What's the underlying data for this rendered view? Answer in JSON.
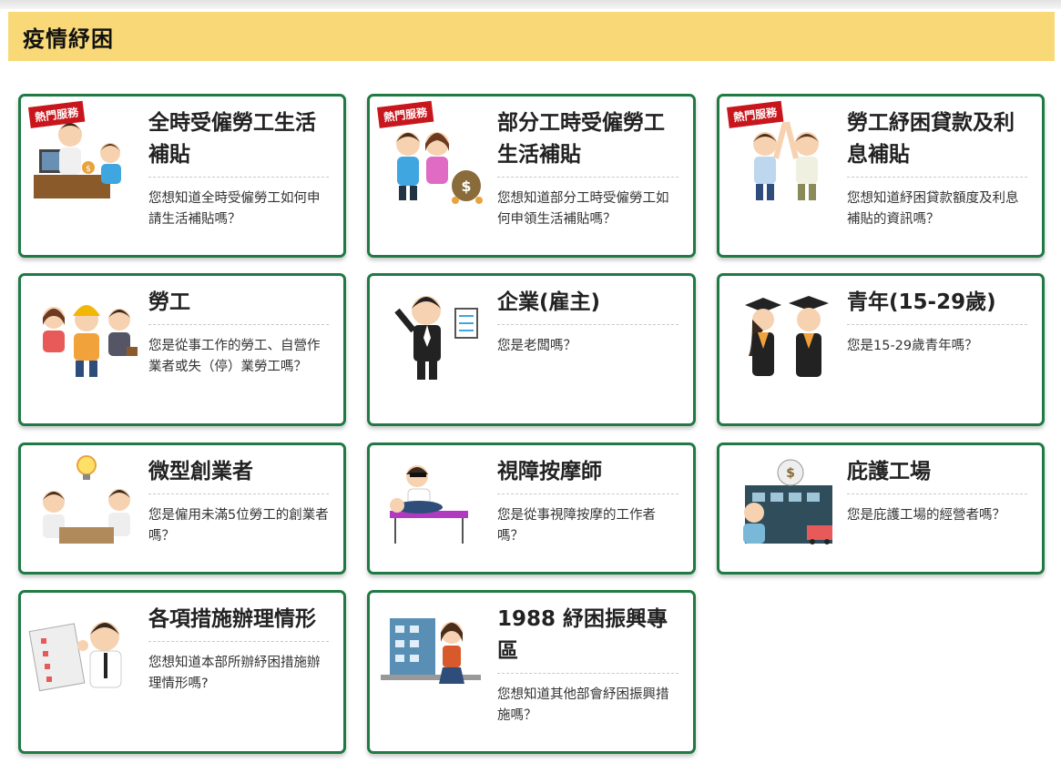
{
  "header": {
    "title": "疫情紓困"
  },
  "hot_label": "熱門服務",
  "cards": [
    {
      "title": "全時受僱勞工生活補貼",
      "desc": "您想知道全時受僱勞工如何申請生活補貼嗎？",
      "hot": true
    },
    {
      "title": "部分工時受僱勞工生活補貼",
      "desc": "您想知道部分工時受僱勞工如何申領生活補貼嗎？",
      "hot": true
    },
    {
      "title": "勞工紓困貸款及利息補貼",
      "desc": "您想知道紓困貸款額度及利息補貼的資訊嗎？",
      "hot": true
    },
    {
      "title": "勞工",
      "desc": "您是從事工作的勞工、自營作業者或失（停）業勞工嗎？",
      "hot": false
    },
    {
      "title": "企業(雇主)",
      "desc": "您是老闆嗎？",
      "hot": false
    },
    {
      "title": "青年(15-29歲)",
      "desc": "您是15-29歲青年嗎？",
      "hot": false
    },
    {
      "title": "微型創業者",
      "desc": "您是僱用未滿5位勞工的創業者嗎？",
      "hot": false
    },
    {
      "title": "視障按摩師",
      "desc": "您是從事視障按摩的工作者嗎？",
      "hot": false
    },
    {
      "title": "庇護工場",
      "desc": "您是庇護工場的經營者嗎？",
      "hot": false
    },
    {
      "title": "各項措施辦理情形",
      "desc": "您想知道本部所辦紓困措施辦理情形嗎?",
      "hot": false
    },
    {
      "title": "1988 紓困振興專區",
      "desc": "您想知道其他部會紓困振興措施嗎？",
      "hot": false
    }
  ],
  "icons": {
    "money": "$"
  }
}
